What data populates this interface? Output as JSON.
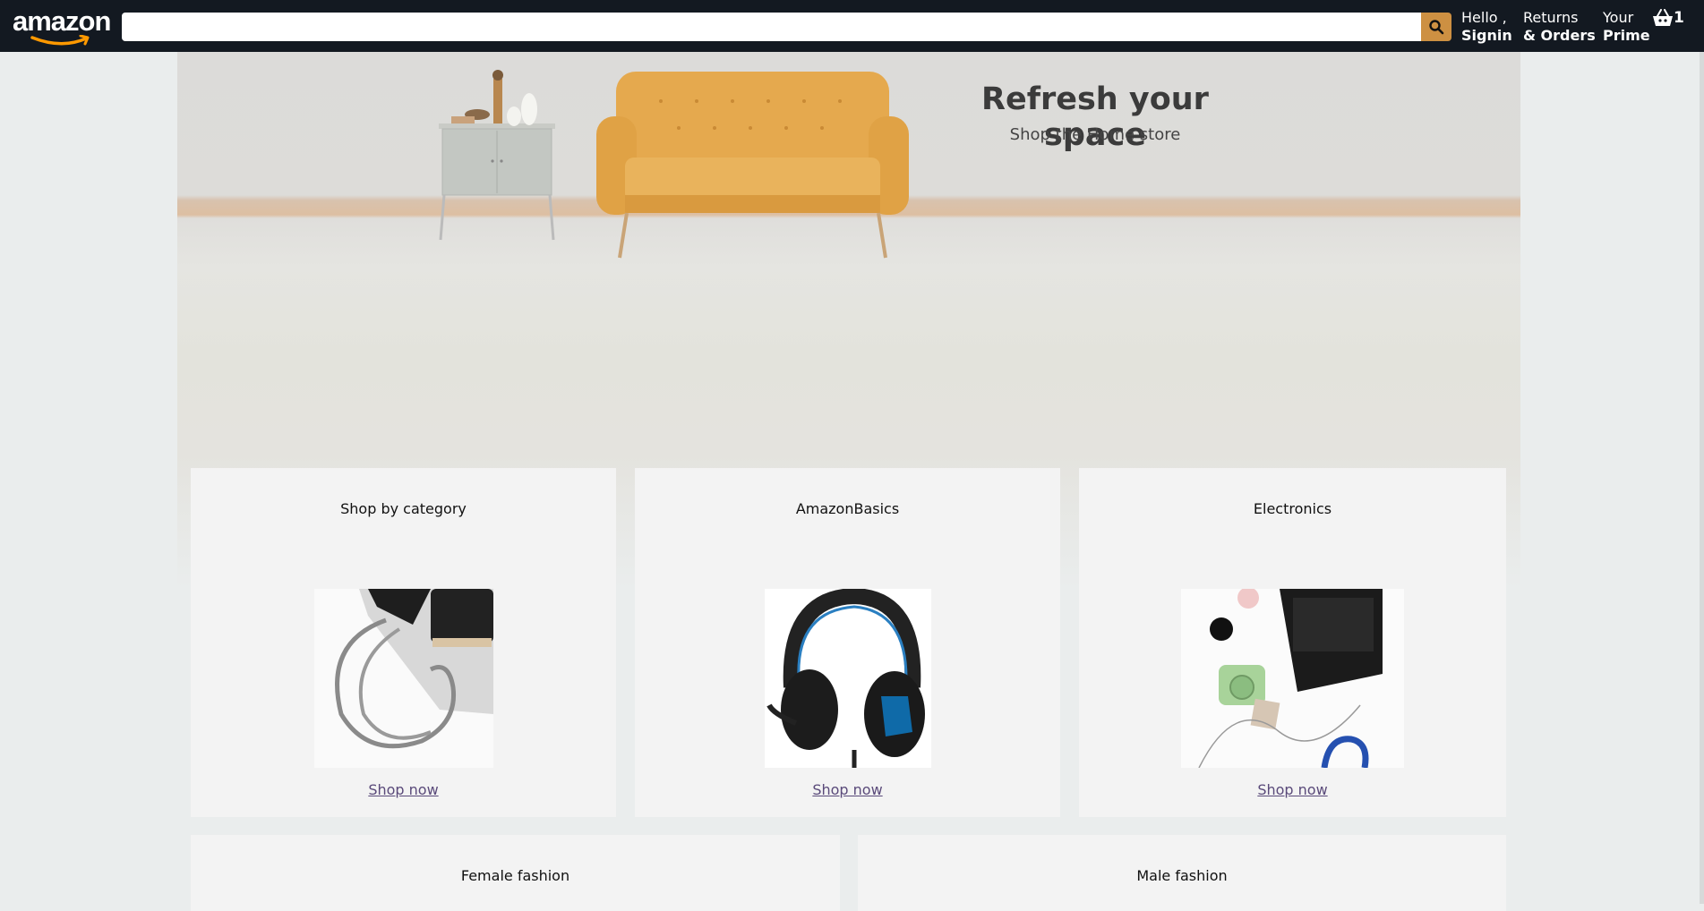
{
  "header": {
    "logo_text": "amazon",
    "search": {
      "value": "",
      "placeholder": ""
    },
    "nav": [
      {
        "line1": "Hello ,",
        "line2": "Signin"
      },
      {
        "line1": "Returns",
        "line2": "& Orders"
      },
      {
        "line1": "Your",
        "line2": "Prime"
      }
    ],
    "basket_count": "1",
    "colors": {
      "bar": "#131921",
      "search_button": "#cd9042"
    }
  },
  "hero": {
    "title": "Refresh your space",
    "subtitle": "Shop the Home store"
  },
  "cards": [
    {
      "title": "Shop by category",
      "link": "Shop now",
      "image": "usb-cable-phone-laptop-image"
    },
    {
      "title": "AmazonBasics",
      "link": "Shop now",
      "image": "gaming-headset-image"
    },
    {
      "title": "Electronics",
      "link": "Shop now",
      "image": "laptop-camera-flatlay-image"
    },
    {
      "title": "Female fashion"
    },
    {
      "title": "Male fashion"
    }
  ]
}
